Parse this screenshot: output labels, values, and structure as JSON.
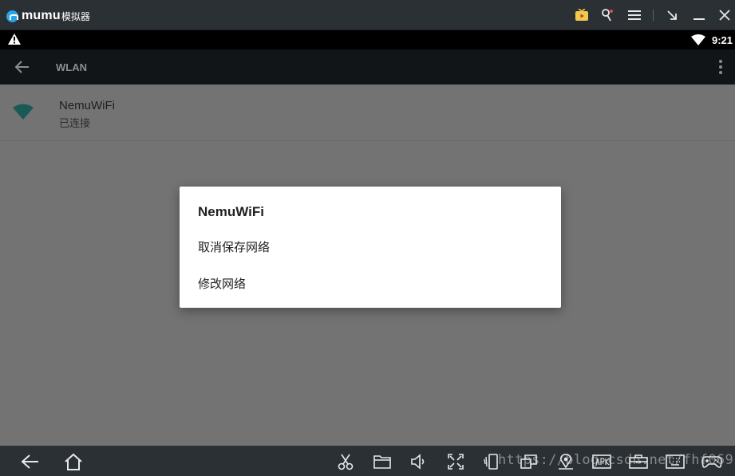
{
  "window": {
    "logo_text": "mumu",
    "logo_sub": "模拟器",
    "controls": [
      "tv-icon",
      "broom-icon",
      "menu-icon",
      "shrink-icon",
      "minimize-icon",
      "close-icon"
    ]
  },
  "status_bar": {
    "time": "9:21",
    "icons": [
      "warning-icon",
      "wifi-icon"
    ]
  },
  "app_bar": {
    "title": "WLAN"
  },
  "network_list": [
    {
      "name": "NemuWiFi",
      "status": "已连接"
    }
  ],
  "dialog": {
    "title": "NemuWiFi",
    "items": [
      "取消保存网络",
      "修改网络"
    ]
  },
  "bottom_toolbar": {
    "icons": [
      "back-icon",
      "home-icon",
      "cut-icon",
      "folder-icon",
      "volume-icon",
      "fullscreen-icon",
      "shake-icon",
      "multi-window-icon",
      "location-icon",
      "apk-icon",
      "toolbox-icon",
      "keyboard-icon",
      "gamepad-icon"
    ]
  },
  "watermark": "https://blog.csdn.net/fhf069",
  "colors": {
    "dialog_bg": "#ffffff",
    "dim_overlay": "#737373",
    "wifi_accent": "#1a5a56",
    "chrome": "#2b3035"
  }
}
